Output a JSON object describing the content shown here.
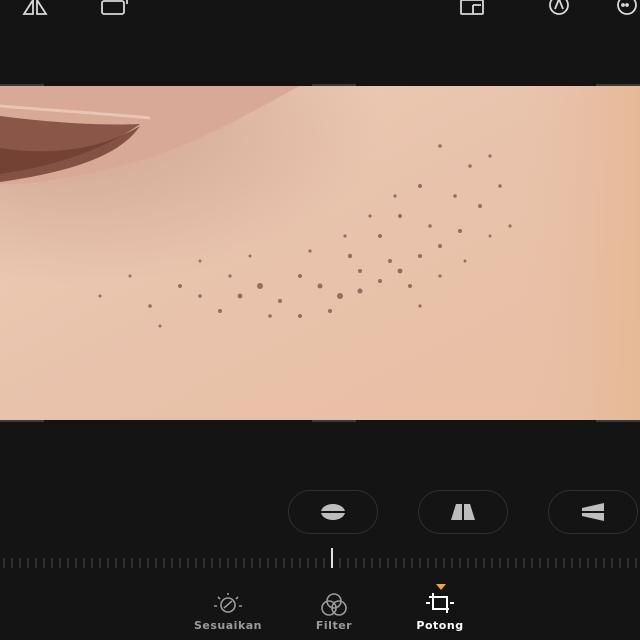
{
  "top_bar": {
    "icons": [
      "flip-icon",
      "aspect-ratio-icon",
      "save-icon",
      "markup-icon",
      "more-icon"
    ]
  },
  "photo": {
    "subject": "close-up skin photo"
  },
  "rotation_controls": {
    "buttons": [
      "rotate-horizontal-icon",
      "perspective-vertical-icon",
      "perspective-horizontal-icon"
    ]
  },
  "tabs": [
    {
      "label": "Sesuaikan",
      "icon": "adjust-icon",
      "active": false
    },
    {
      "label": "Filter",
      "icon": "filter-icon",
      "active": false
    },
    {
      "label": "Potong",
      "icon": "crop-icon",
      "active": true
    }
  ],
  "colors": {
    "background": "#141414",
    "accent": "#f0a830",
    "active_text": "#ffffff",
    "inactive_text": "#9a9a9a"
  }
}
